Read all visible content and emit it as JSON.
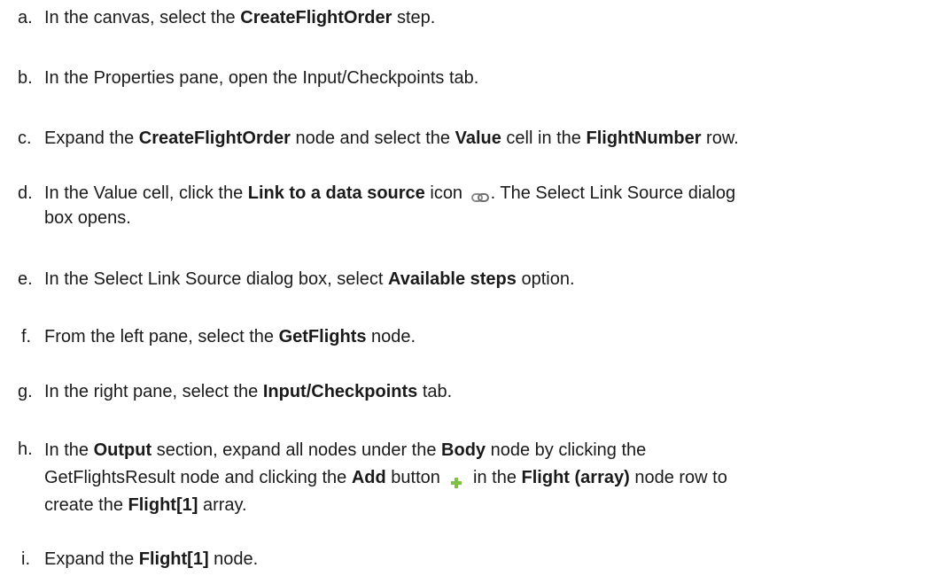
{
  "steps": [
    {
      "marker": "a.",
      "parts": [
        "In the canvas, select the ",
        "CreateFlightOrder",
        " step."
      ]
    },
    {
      "marker": "b.",
      "parts": [
        "In the Properties pane, open the Input/Checkpoints tab."
      ]
    },
    {
      "marker": "c.",
      "parts": [
        "Expand the ",
        "CreateFlightOrder",
        " node and select the ",
        "Value",
        " cell in the ",
        "FlightNumber",
        " row."
      ]
    },
    {
      "marker": "d.",
      "parts": [
        "In the Value cell, click the ",
        "Link to a data source",
        " icon ",
        ". The Select Link Source dialog",
        "box opens."
      ]
    },
    {
      "marker": "e.",
      "parts": [
        "In the Select Link Source dialog box, select ",
        "Available steps",
        " option."
      ]
    },
    {
      "marker": "f.",
      "parts": [
        "From the left pane, select the ",
        "GetFlights",
        " node."
      ]
    },
    {
      "marker": "g.",
      "parts": [
        "In the right pane, select the ",
        "Input/Checkpoints",
        " tab."
      ]
    },
    {
      "marker": "h.",
      "parts": [
        "In the ",
        "Output",
        " section, expand all nodes under the ",
        "Body",
        " node by clicking the",
        "GetFlightsResult node and clicking the ",
        "Add",
        " button ",
        " in the ",
        "Flight (array)",
        " node row to",
        "create the ",
        "Flight[1]",
        " array."
      ]
    },
    {
      "marker": "i.",
      "parts": [
        "Expand the ",
        "Flight[1]",
        " node."
      ]
    }
  ],
  "icons": {
    "link_icon": "link-to-data-source-icon",
    "add_icon": "add-plus-icon",
    "add_color": "#7dc242"
  }
}
